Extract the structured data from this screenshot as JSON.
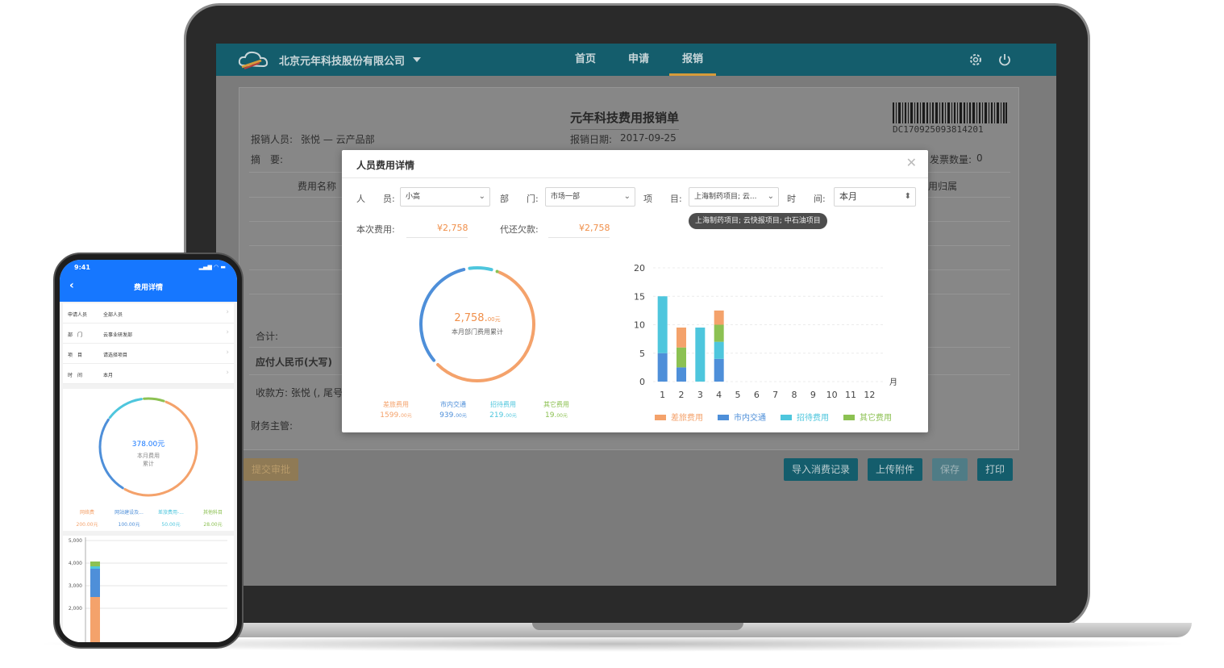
{
  "desktop": {
    "company": "北京元年科技股份有限公司",
    "nav": [
      "首页",
      "申请",
      "报销"
    ],
    "active_nav": "报销",
    "form": {
      "title": "元年科技费用报销单",
      "barcode": "DC170925093814201",
      "reporter_label": "报销人员:",
      "reporter_value": "张悦 — 云产品部",
      "summary_label": "摘　要:",
      "date_label": "报销日期:",
      "date_value": "2017-09-25",
      "invoice_label": "发票数量:",
      "invoice_value": "0",
      "col_expense_name": "费用名称",
      "col_owner": "用归属",
      "total_label": "合计:",
      "payable_label": "应付人民币(大写)",
      "payee_label": "收款方: 张悦 (, 尾号",
      "finance_label": "财务主管:"
    },
    "buttons": {
      "submit": "提交审批",
      "import": "导入消费记录",
      "upload": "上传附件",
      "save": "保存",
      "print": "打印"
    }
  },
  "modal": {
    "title": "人员费用详情",
    "filters": {
      "person_label": "人　　员:",
      "person_value": "小高",
      "dept_label": "部　　门:",
      "dept_value": "市场一部",
      "project_label": "项　　目:",
      "project_value": "上海制药项目; 云...",
      "time_label": "时　　间:",
      "time_value": "本月"
    },
    "tooltip": "上海制药项目; 云快报项目; 中石油项目",
    "this_cost_label": "本次费用:",
    "this_cost_value": "¥2,758",
    "owed_label": "代还欠款:",
    "owed_value": "¥2,758",
    "donut_total": "2,758.",
    "donut_total_unit": "00元",
    "donut_caption": "本月部门费用累计",
    "donut_legend": [
      {
        "name": "差旅费用",
        "value": "1599.",
        "unit": "00元",
        "color": "#f4a26b"
      },
      {
        "name": "市内交通",
        "value": "939.",
        "unit": "00元",
        "color": "#4e8fd9"
      },
      {
        "name": "招待费用",
        "value": "219.",
        "unit": "00元",
        "color": "#4ec6dd"
      },
      {
        "name": "其它费用",
        "value": "19.",
        "unit": "00元",
        "color": "#8cc152"
      }
    ],
    "bar_legend": [
      "差旅费用",
      "市内交通",
      "招待费用",
      "其它费用"
    ]
  },
  "chart_data": {
    "type": "bar",
    "stacked": true,
    "categories": [
      "1",
      "2",
      "3",
      "4",
      "5",
      "6",
      "7",
      "8",
      "9",
      "10",
      "11",
      "12"
    ],
    "xlabel": "月",
    "ylim": [
      0,
      20
    ],
    "yticks": [
      "0",
      "5",
      "10",
      "15",
      "20"
    ],
    "series": [
      {
        "name": "市内交通",
        "color": "#4e8fd9",
        "values": [
          5,
          2.5,
          0,
          4,
          0,
          0,
          0,
          0,
          0,
          0,
          0,
          0
        ]
      },
      {
        "name": "招待费用",
        "color": "#4ec6dd",
        "values": [
          10,
          0,
          9.5,
          3,
          0,
          0,
          0,
          0,
          0,
          0,
          0,
          0
        ]
      },
      {
        "name": "其它费用",
        "color": "#8cc152",
        "values": [
          0,
          3.5,
          0,
          3,
          0,
          0,
          0,
          0,
          0,
          0,
          0,
          0
        ]
      },
      {
        "name": "差旅费用",
        "color": "#f4a26b",
        "values": [
          0,
          3.5,
          0,
          2.5,
          0,
          0,
          0,
          0,
          0,
          0,
          0,
          0
        ]
      }
    ]
  },
  "phone": {
    "time": "9:41",
    "title": "费用详情",
    "rows": [
      {
        "label": "申请人员",
        "value": "全部人员"
      },
      {
        "label": "部　门",
        "value": "云事业研发部"
      },
      {
        "label": "项　目",
        "value": "请选择项目"
      },
      {
        "label": "时　间",
        "value": "本月"
      }
    ],
    "donut_total": "378.00元",
    "donut_caption1": "本月费用",
    "donut_caption2": "累计",
    "legend": [
      {
        "name": "网络费",
        "value": "200.00元",
        "color": "#f4a26b"
      },
      {
        "name": "网站建设及...",
        "value": "100.00元",
        "color": "#4e8fd9"
      },
      {
        "name": "差旅费用-...",
        "value": "50.00元",
        "color": "#4ec6dd"
      },
      {
        "name": "其他科目",
        "value": "28.00元",
        "color": "#8cc152"
      }
    ],
    "bar_yticks": [
      "5,000",
      "4,000",
      "3,000",
      "2,000"
    ]
  }
}
